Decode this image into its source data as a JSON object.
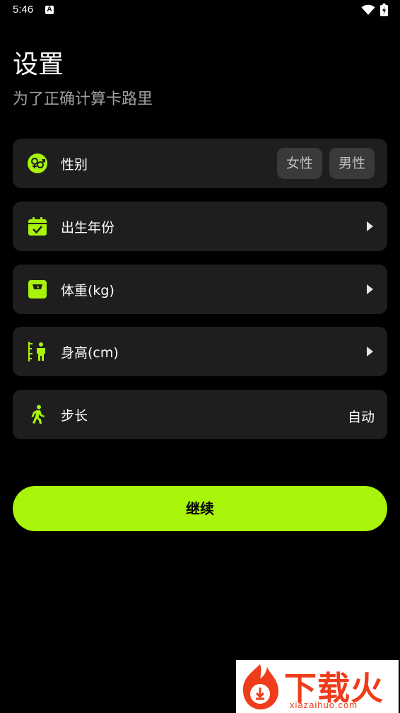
{
  "status_bar": {
    "time": "5:46",
    "notification_letter": "A"
  },
  "header": {
    "title": "设置",
    "subtitle": "为了正确计算卡路里"
  },
  "settings": {
    "gender": {
      "label": "性别",
      "icon": "gender-icon",
      "options": [
        "女性",
        "男性"
      ]
    },
    "birth_year": {
      "label": "出生年份",
      "icon": "calendar-icon"
    },
    "weight": {
      "label": "体重(kg)",
      "icon": "scale-icon"
    },
    "height": {
      "label": "身高(cm)",
      "icon": "height-icon"
    },
    "stride": {
      "label": "步长",
      "icon": "walking-icon",
      "value": "自动"
    }
  },
  "actions": {
    "continue_label": "继续"
  },
  "watermark": {
    "text": "下载火",
    "url": "xiazaihuo.com"
  },
  "colors": {
    "accent": "#a8f40a",
    "card_bg": "#1e1e1e",
    "background": "#000000",
    "segment_bg": "#3a3a3a"
  }
}
